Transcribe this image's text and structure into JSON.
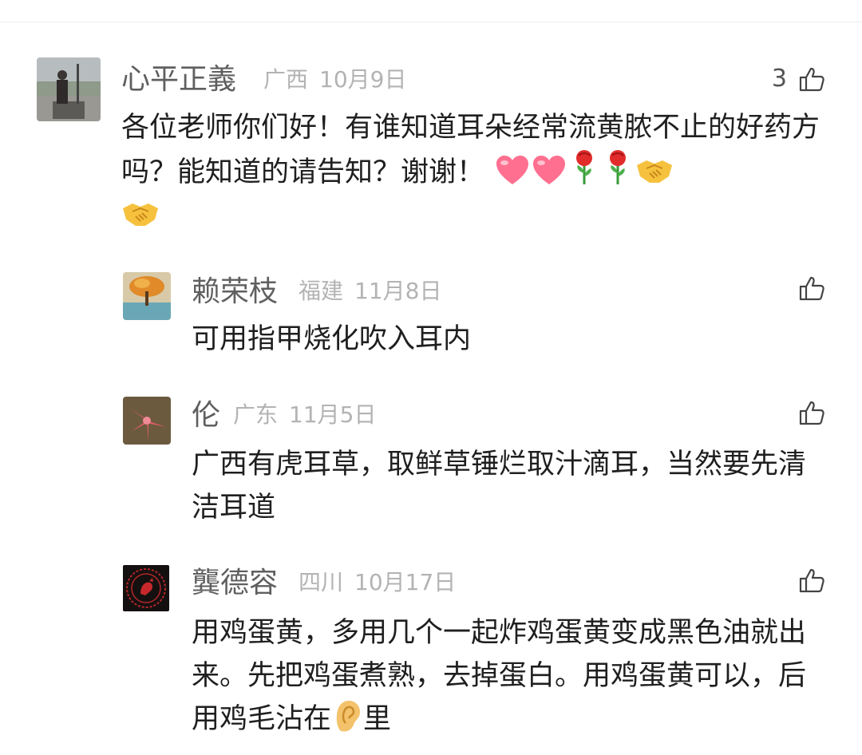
{
  "comments": [
    {
      "user": "心平正義",
      "region": "广西",
      "date": "10月9日",
      "likes": "3",
      "text": "各位老师你们好！有谁知道耳朵经常流黄脓不止的好药方吗？能知道的请告知？谢谢！",
      "emojis": [
        "heart-icon",
        "heart-icon",
        "rose-icon",
        "rose-icon",
        "handshake-icon",
        "handshake-icon"
      ]
    },
    {
      "user": "赖荣枝",
      "region": "福建",
      "date": "11月8日",
      "text": "可用指甲烧化吹入耳内"
    },
    {
      "user": "伦",
      "region": "广东",
      "date": "11月5日",
      "text": "广西有虎耳草，取鲜草锤烂取汁滴耳，当然要先清洁耳道"
    },
    {
      "user": "龔德容",
      "region": "四川",
      "date": "10月17日",
      "text_before": "用鸡蛋黄，多用几个一起炸鸡蛋黄变成黑色油就出来。先把鸡蛋煮熟，去掉蛋白。用鸡蛋黄可以，后用鸡毛沾在",
      "text_after": "里"
    }
  ]
}
